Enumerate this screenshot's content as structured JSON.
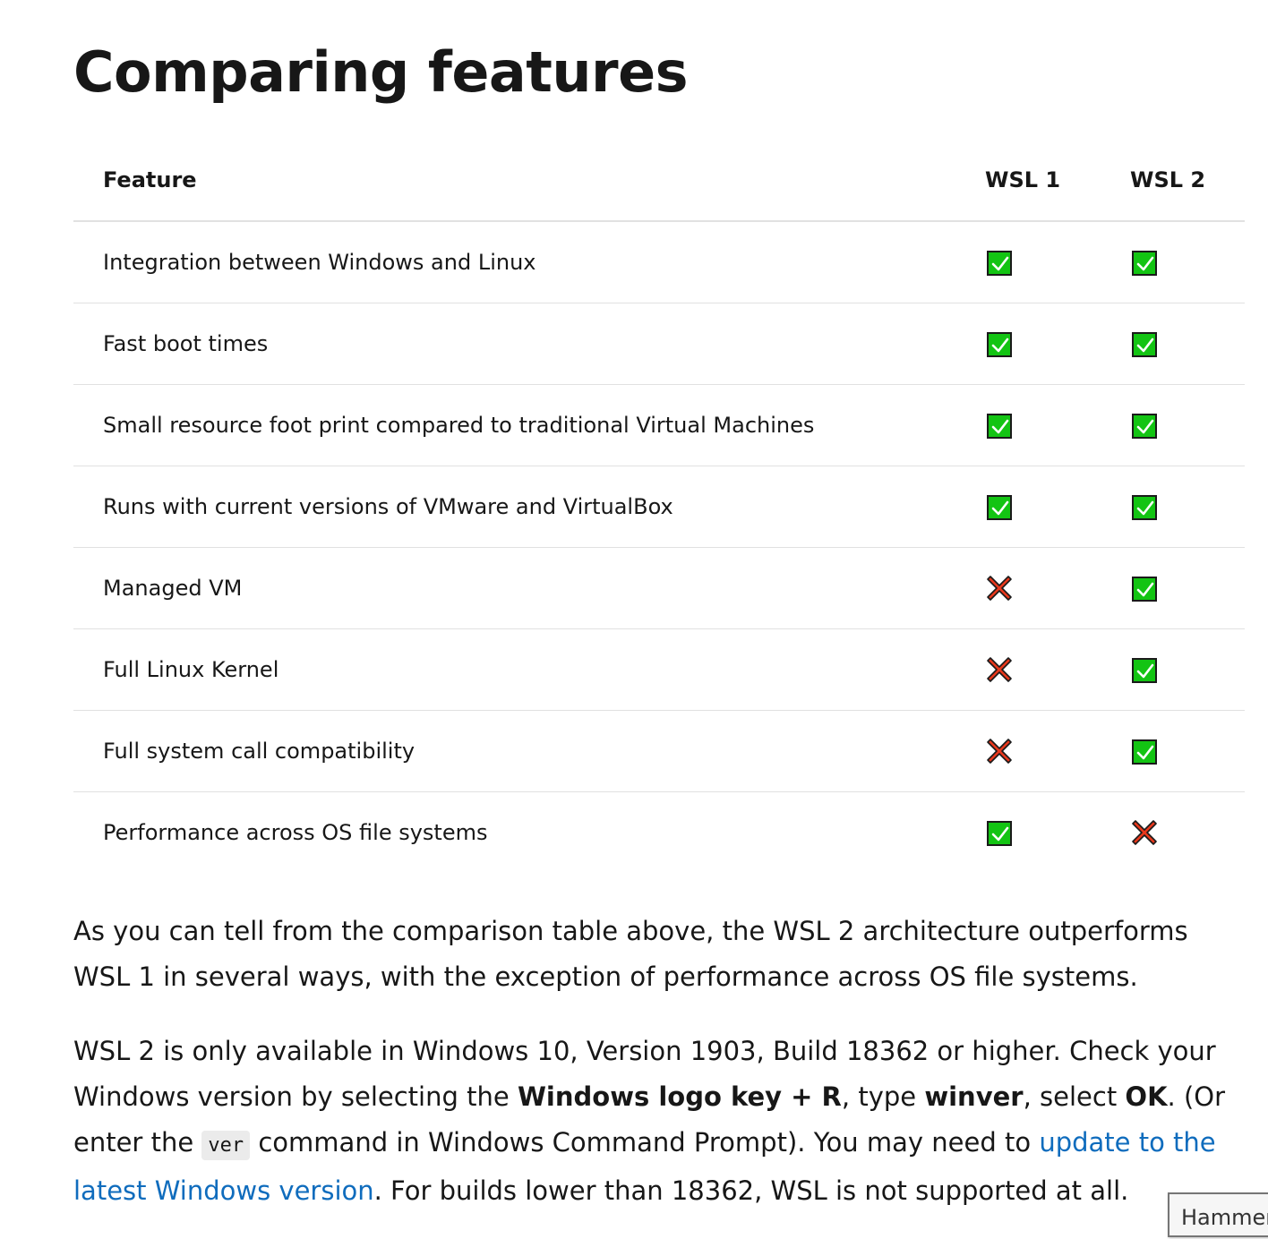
{
  "heading": "Comparing features",
  "table": {
    "headers": {
      "feature": "Feature",
      "wsl1": "WSL 1",
      "wsl2": "WSL 2"
    },
    "rows": [
      {
        "feature": "Integration between Windows and Linux",
        "wsl1": "check",
        "wsl2": "check"
      },
      {
        "feature": "Fast boot times",
        "wsl1": "check",
        "wsl2": "check"
      },
      {
        "feature": "Small resource foot print compared to traditional Virtual Machines",
        "wsl1": "check",
        "wsl2": "check"
      },
      {
        "feature": "Runs with current versions of VMware and VirtualBox",
        "wsl1": "check",
        "wsl2": "check"
      },
      {
        "feature": "Managed VM",
        "wsl1": "cross",
        "wsl2": "check"
      },
      {
        "feature": "Full Linux Kernel",
        "wsl1": "cross",
        "wsl2": "check"
      },
      {
        "feature": "Full system call compatibility",
        "wsl1": "cross",
        "wsl2": "check"
      },
      {
        "feature": "Performance across OS file systems",
        "wsl1": "check",
        "wsl2": "cross"
      }
    ]
  },
  "paragraph1": "As you can tell from the comparison table above, the WSL 2 architecture outperforms WSL 1 in several ways, with the exception of performance across OS file systems.",
  "paragraph2": {
    "t1": "WSL 2 is only available in Windows 10, Version 1903, Build 18362 or higher. Check your Windows version by selecting the ",
    "b1": "Windows logo key + R",
    "t2": ", type ",
    "b2": "winver",
    "t3": ", select ",
    "b3": "OK",
    "t4": ". (Or enter the ",
    "code": "ver",
    "t5": " command in Windows Command Prompt). You may need to ",
    "link": "update to the latest Windows version",
    "t6": ". For builds lower than 18362, WSL is not supported at all."
  },
  "tooltip": "Hammer",
  "colors": {
    "check_fill": "#13c413",
    "cross_fill": "#e8381c",
    "link": "#0f6cbd"
  },
  "icons": {
    "check": "check-mark-button-icon",
    "cross": "cross-mark-icon"
  }
}
